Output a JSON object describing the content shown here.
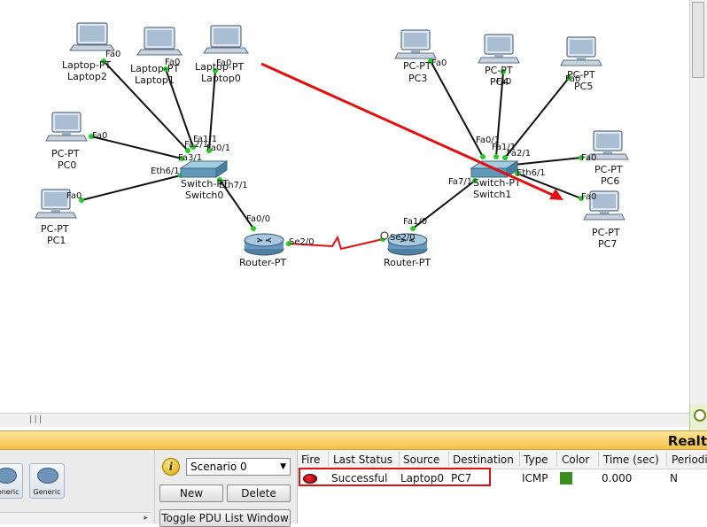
{
  "topology": {
    "devices": {
      "laptop2": {
        "type": "Laptop-PT",
        "name": "Laptop2"
      },
      "laptop1": {
        "type": "Laptop-PT",
        "name": "Laptop1"
      },
      "laptop0": {
        "type": "Laptop-PT",
        "name": "Laptop0"
      },
      "pc0": {
        "type": "PC-PT",
        "name": "PC0"
      },
      "pc1": {
        "type": "PC-PT",
        "name": "PC1"
      },
      "pc3": {
        "type": "PC-PT",
        "name": "PC3"
      },
      "pc4": {
        "type": "PC-PT",
        "name": "PC4"
      },
      "pc5": {
        "type": "PC-PT",
        "name": "PC5"
      },
      "pc6": {
        "type": "PC-PT",
        "name": "PC6"
      },
      "pc7": {
        "type": "PC-PT",
        "name": "PC7"
      },
      "switch0": {
        "type": "Switch-PT",
        "name": "Switch0"
      },
      "switch1": {
        "type": "Switch-PT",
        "name": "Switch1"
      },
      "router0": {
        "type": "Router-PT"
      },
      "router1": {
        "type": "Router-PT"
      }
    },
    "ports": {
      "laptop2_fa0": "Fa0",
      "laptop1_fa0": "Fa0",
      "laptop0_fa0": "Fa0",
      "pc0_fa0": "Fa0",
      "pc1_fa0": "Fa0",
      "sw0_fa1": "Fa1/1",
      "sw0_fa2": "Fa2/1",
      "sw0_fa0": "Fa0/1",
      "sw0_fa3": "Fa3/1",
      "sw0_eth6": "Eth6/1",
      "sw0_eth7": "Eth7/1",
      "r0_fa0": "Fa0/0",
      "r0_se2": "Se2/0",
      "r1_se2": "Se2/0",
      "r1_fa1": "Fa1/0",
      "pc3_fa0": "Fa0",
      "pc4_fa0": "Fa0",
      "pc5_fa0": "Fa0",
      "pc6_fa0": "Fa0",
      "pc7_fa0": "Fa0",
      "sw1_fa0": "Fa0/1",
      "sw1_fa1": "Fa1/1",
      "sw1_fa2": "Fa2/1",
      "sw1_eth6": "Eth6/1",
      "sw1_fa7": "Fa7/1"
    }
  },
  "realtime_label": "Realt",
  "device_panel": {
    "items": [
      "Generic",
      "Generic"
    ]
  },
  "scenario": {
    "selected": "Scenario 0",
    "new_label": "New",
    "delete_label": "Delete",
    "toggle_label": "Toggle PDU List Window"
  },
  "pdu_list": {
    "headers": {
      "fire": "Fire",
      "last_status": "Last Status",
      "source": "Source",
      "destination": "Destination",
      "type": "Type",
      "color": "Color",
      "time": "Time (sec)",
      "periodic": "Periodi"
    },
    "rows": [
      {
        "last_status": "Successful",
        "source": "Laptop0",
        "destination": "PC7",
        "type": "ICMP",
        "color": "#3a8f1a",
        "time": "0.000",
        "periodic": "N"
      }
    ]
  },
  "colors": {
    "annotation": "#e01010",
    "link_up": "#22cc22",
    "serial_link": "#e01010"
  }
}
